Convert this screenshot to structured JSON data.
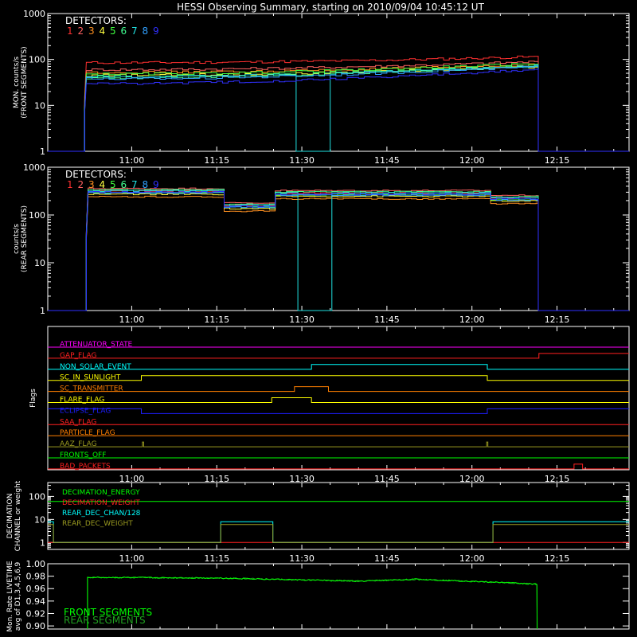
{
  "title": "HESSI Observing Summary, starting on 2010/09/04 10:45:12 UT",
  "colors": {
    "fg": "#ffffff",
    "det": [
      "#ff3030",
      "#ff6060",
      "#ff9020",
      "#ffff40",
      "#40ff40",
      "#40ff90",
      "#20e0e0",
      "#30a0ff",
      "#3030ff"
    ],
    "cyan": "#00ffff",
    "red": "#ff2020",
    "magenta": "#ff00ff",
    "orange": "#ff7f00",
    "yellow": "#ffff00",
    "blue": "#1e1eff",
    "olive": "#9a9a20",
    "green": "#00ff00",
    "livetime_front": "#00ff00",
    "livetime_rear": "#20a020"
  },
  "time_axis": {
    "start_min": 0,
    "end_min": 102.5,
    "ticks": [
      {
        "min": 14.8,
        "label": "11:00"
      },
      {
        "min": 29.8,
        "label": "11:15"
      },
      {
        "min": 44.8,
        "label": "11:30"
      },
      {
        "min": 59.8,
        "label": "11:45"
      },
      {
        "min": 74.8,
        "label": "12:00"
      },
      {
        "min": 89.8,
        "label": "12:15"
      }
    ]
  },
  "detectors_legend": {
    "label": "DETECTORS:",
    "numbers": [
      "1",
      "2",
      "3",
      "4",
      "5",
      "6",
      "7",
      "8",
      "9"
    ]
  },
  "chart_data": [
    {
      "type": "line",
      "panel": "front",
      "ylabel": [
        "MON. counts/s",
        "(FRONT SEGMENTS)"
      ],
      "yscale": "log",
      "ylim": [
        1,
        1000
      ],
      "yticks": [
        {
          "v": 1,
          "label": "1"
        },
        {
          "v": 10,
          "label": "10"
        },
        {
          "v": 100,
          "label": "100"
        },
        {
          "v": 1000,
          "label": "1000"
        }
      ],
      "data_window_min": [
        6.5,
        86.5
      ],
      "series": [
        {
          "start": 85,
          "end": 115,
          "edge_left": 15
        },
        {
          "start": 60,
          "end": 90,
          "edge_left": 12
        },
        {
          "start": 52,
          "end": 78,
          "edge_left": 10
        },
        {
          "start": 45,
          "end": 70,
          "edge_left": 9
        },
        {
          "start": 48,
          "end": 82,
          "edge_left": 9
        },
        {
          "start": 40,
          "end": 75,
          "edge_left": 8
        },
        {
          "start": 42,
          "end": 72,
          "edge_left": 8,
          "gap_min": [
            43.5,
            49.5
          ],
          "gap_value": 1
        },
        {
          "start": 38,
          "end": 70,
          "edge_left": 7
        },
        {
          "start": 30,
          "end": 60,
          "edge_left": 7
        }
      ]
    },
    {
      "type": "line",
      "panel": "rear",
      "ylabel": [
        "counts/s",
        "(REAR SEGMENTS)"
      ],
      "yscale": "log",
      "ylim": [
        1,
        1000
      ],
      "yticks": [
        {
          "v": 1,
          "label": "1"
        },
        {
          "v": 10,
          "label": "10"
        },
        {
          "v": 100,
          "label": "100"
        },
        {
          "v": 1000,
          "label": "1000"
        }
      ],
      "data_window_min": [
        6.8,
        86.5
      ],
      "profile": [
        {
          "from": 6.8,
          "to": 30.5,
          "v": 320
        },
        {
          "from": 30.5,
          "to": 39.7,
          "v": 160
        },
        {
          "from": 39.7,
          "to": 77.5,
          "v": 290
        },
        {
          "from": 77.5,
          "to": 86.5,
          "v": 230
        }
      ],
      "series_scale": [
        1.0,
        1.12,
        0.75,
        0.85,
        0.92,
        1.05,
        1.0,
        0.9,
        0.95
      ],
      "gap_series": 6,
      "gap_min": [
        43.5,
        49.5
      ]
    },
    {
      "type": "step",
      "panel": "flags",
      "ylabel": "Flags",
      "flags": [
        {
          "name": "ATTENUATOR_STATE",
          "color": "magenta",
          "steps": []
        },
        {
          "name": "GAP_FLAG",
          "color": "red",
          "steps": [
            [
              0,
              0
            ],
            [
              86.6,
              1
            ]
          ]
        },
        {
          "name": "NON_SOLAR_EVENT",
          "color": "cyan",
          "steps": [
            [
              0,
              0
            ],
            [
              46.5,
              1
            ],
            [
              77.5,
              0
            ]
          ]
        },
        {
          "name": "SC_IN_SUNLIGHT",
          "color": "yellow",
          "steps": [
            [
              0,
              0
            ],
            [
              16.5,
              1
            ],
            [
              77.5,
              0
            ]
          ]
        },
        {
          "name": "SC_TRANSMITTER",
          "color": "orange",
          "steps": [
            [
              0,
              0
            ],
            [
              43.5,
              1
            ],
            [
              49.5,
              0
            ]
          ]
        },
        {
          "name": "FLARE_FLAG",
          "color": "yellow",
          "steps": [
            [
              0,
              0
            ],
            [
              39.5,
              1
            ],
            [
              46.5,
              0
            ]
          ]
        },
        {
          "name": "ECLIPSE_FLAG",
          "color": "blue",
          "steps": [
            [
              0,
              1
            ],
            [
              16.5,
              0
            ],
            [
              77.5,
              1
            ]
          ]
        },
        {
          "name": "SAA_FLAG",
          "color": "red",
          "steps": []
        },
        {
          "name": "PARTICLE_FLAG",
          "color": "orange",
          "steps": []
        },
        {
          "name": "AAZ_FLAG",
          "color": "olive",
          "spikes": [
            16.7,
            77.4
          ]
        },
        {
          "name": "FRONTS_OFF",
          "color": "green",
          "steps": []
        },
        {
          "name": "BAD_PACKETS",
          "color": "red",
          "steps": [
            [
              0,
              0
            ],
            [
              92.8,
              1
            ],
            [
              94.3,
              0
            ]
          ]
        }
      ]
    },
    {
      "type": "step",
      "panel": "decimation",
      "ylabel": [
        "DECIMATION",
        "CHANNEL or weight"
      ],
      "yscale": "log",
      "ylim": [
        0.5,
        400
      ],
      "yticks": [
        {
          "v": 1,
          "label": "1"
        },
        {
          "v": 10,
          "label": "10"
        },
        {
          "v": 100,
          "label": "100"
        }
      ],
      "legend": [
        {
          "name": "DECIMATION_ENERGY",
          "color": "green"
        },
        {
          "name": "DECIMATION_WEIGHT",
          "color": "red"
        },
        {
          "name": "REAR_DEC_CHAN/128",
          "color": "cyan"
        },
        {
          "name": "REAR_DEC_WEIGHT",
          "color": "olive"
        }
      ],
      "series": [
        {
          "name": "DECIMATION_ENERGY",
          "steps": [
            [
              0,
              60
            ]
          ]
        },
        {
          "name": "DECIMATION_WEIGHT",
          "steps": [
            [
              0,
              1
            ]
          ]
        },
        {
          "name": "REAR_DEC_CHAN/128",
          "steps": [
            [
              0,
              8
            ],
            [
              1,
              1
            ],
            [
              30.5,
              8
            ],
            [
              39.7,
              1
            ],
            [
              78.5,
              8
            ]
          ]
        },
        {
          "name": "REAR_DEC_WEIGHT",
          "steps": [
            [
              0,
              6
            ],
            [
              1,
              1
            ],
            [
              30.5,
              6
            ],
            [
              39.7,
              1
            ],
            [
              78.5,
              6
            ]
          ]
        }
      ]
    },
    {
      "type": "line",
      "panel": "livetime",
      "ylabel": [
        "Mon. Rate LIVETIME",
        "avg of D1,3,4,5,6,9"
      ],
      "ylim": [
        0.895,
        1.0
      ],
      "yticks": [
        {
          "v": 0.9,
          "label": "0.90"
        },
        {
          "v": 0.92,
          "label": "0.92"
        },
        {
          "v": 0.94,
          "label": "0.94"
        },
        {
          "v": 0.96,
          "label": "0.96"
        },
        {
          "v": 0.98,
          "label": "0.98"
        },
        {
          "v": 1.0,
          "label": "1.00"
        }
      ],
      "data_window_min": [
        7.0,
        86.3
      ],
      "profile": [
        {
          "min": 7.0,
          "v": 0.978
        },
        {
          "min": 30,
          "v": 0.977
        },
        {
          "min": 45,
          "v": 0.974
        },
        {
          "min": 55,
          "v": 0.972
        },
        {
          "min": 65,
          "v": 0.975
        },
        {
          "min": 80,
          "v": 0.97
        },
        {
          "min": 86.3,
          "v": 0.967
        }
      ],
      "legend": [
        {
          "name": "FRONT SEGMENTS",
          "color": "livetime_front"
        },
        {
          "name": "REAR SEGMENTS",
          "color": "livetime_rear"
        }
      ]
    }
  ]
}
